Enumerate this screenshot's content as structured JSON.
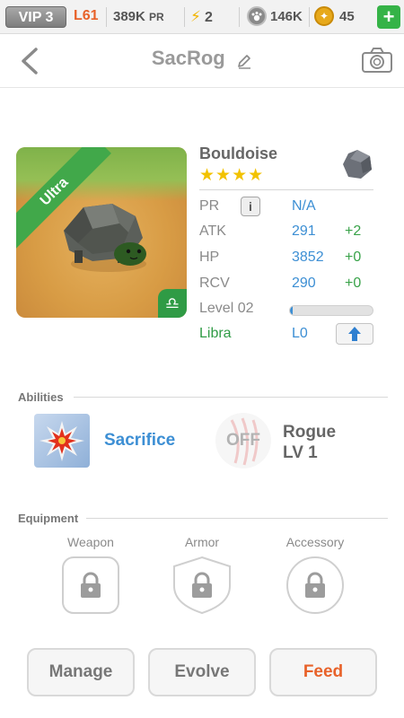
{
  "status_bar": {
    "vip": "VIP 3",
    "level": "L61",
    "pr_value": "389K",
    "pr_unit": "PR",
    "energy": "2",
    "paws": "146K",
    "coins": "45",
    "plus": "+"
  },
  "header": {
    "title": "SacRog"
  },
  "monster": {
    "rarity": "Ultra",
    "name": "Bouldoise",
    "stars": "★★★★",
    "element_icon": "stone-element-icon",
    "sign_symbol": "♎"
  },
  "stats": {
    "pr": {
      "label": "PR",
      "value": "N/A",
      "info": "i"
    },
    "atk": {
      "label": "ATK",
      "value": "291",
      "bonus": "+2"
    },
    "hp": {
      "label": "HP",
      "value": "3852",
      "bonus": "+0"
    },
    "rcv": {
      "label": "RCV",
      "value": "290",
      "bonus": "+0"
    },
    "level": {
      "label": "Level 02",
      "progress": 0.03
    },
    "sign": {
      "label": "Libra",
      "value": "L0"
    }
  },
  "abilities": {
    "section": "Abilities",
    "skill_name": "Sacrifice",
    "passive_state": "OFF",
    "passive_name": "Rogue",
    "passive_level": "LV 1"
  },
  "equipment": {
    "section": "Equipment",
    "slots": [
      "Weapon",
      "Armor",
      "Accessory"
    ]
  },
  "actions": {
    "manage": "Manage",
    "evolve": "Evolve",
    "feed": "Feed"
  },
  "colors": {
    "accent_blue": "#3d8fd4",
    "accent_orange": "#e8622a",
    "accent_green": "#3aa34a",
    "star_gold": "#f2c200"
  }
}
